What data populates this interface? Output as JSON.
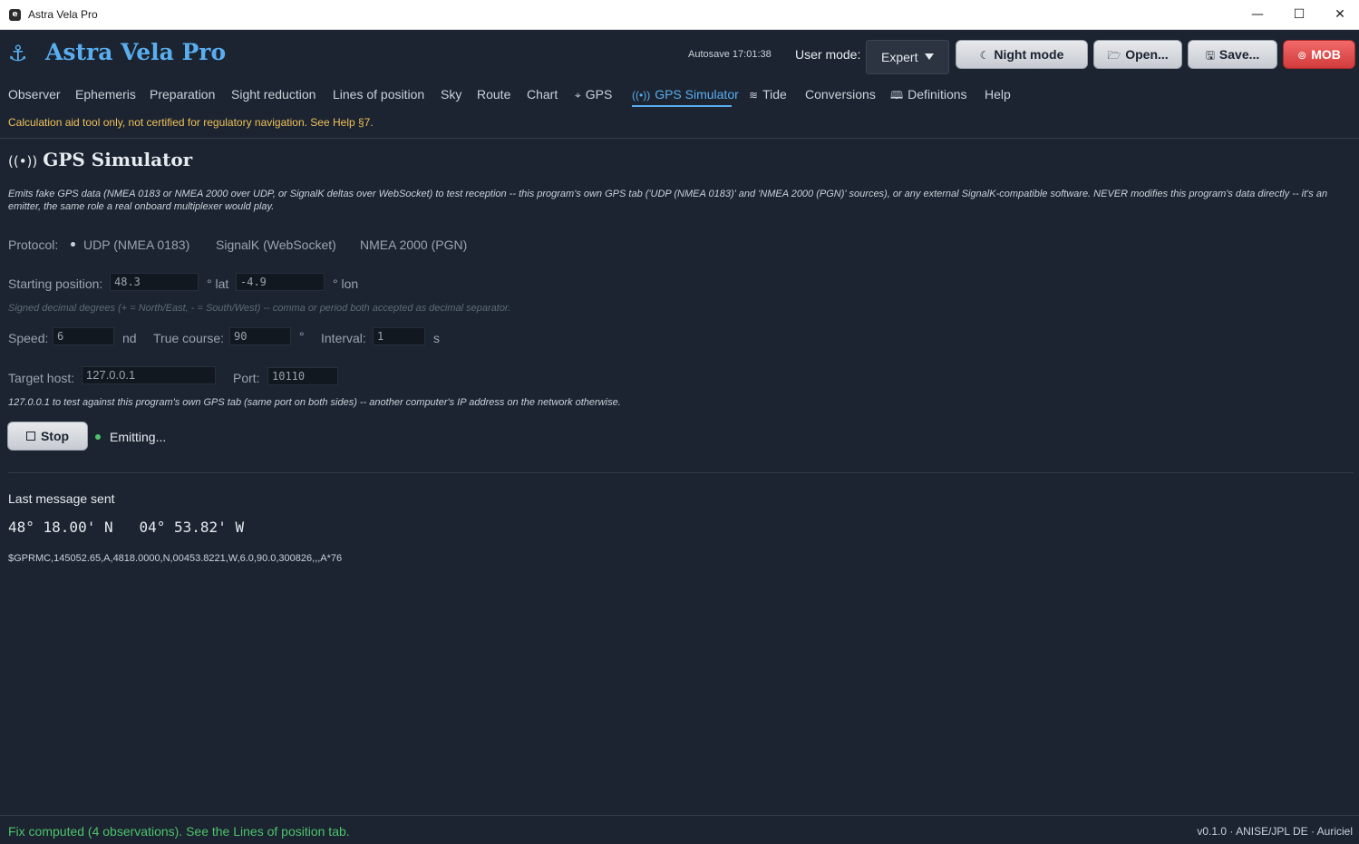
{
  "window": {
    "title": "Astra Vela Pro",
    "app_icon": "e",
    "controls": {
      "minimize": "—",
      "maximize": "☐",
      "close": "✕"
    }
  },
  "header": {
    "brand": "Astra Vela Pro",
    "brand_icon": "anchor-icon",
    "autosave": "Autosave 17:01:38",
    "user_mode_label": "User mode:",
    "user_mode_value": "Expert",
    "buttons": {
      "night_mode": "Night mode",
      "open": "Open...",
      "save": "Save...",
      "mob": "MOB"
    }
  },
  "tabs": [
    {
      "label": "Observer"
    },
    {
      "label": "Ephemeris"
    },
    {
      "label": "Preparation"
    },
    {
      "label": "Sight reduction"
    },
    {
      "label": "Lines of position"
    },
    {
      "label": "Sky"
    },
    {
      "label": "Route"
    },
    {
      "label": "Chart"
    },
    {
      "label": "GPS",
      "icon": "crosshair-icon"
    },
    {
      "label": "GPS Simulator",
      "icon": "broadcast-icon",
      "active": true
    },
    {
      "label": "Tide",
      "icon": "waves-icon"
    },
    {
      "label": "Conversions"
    },
    {
      "label": "Definitions",
      "icon": "book-icon"
    },
    {
      "label": "Help"
    }
  ],
  "disclaimer": "Calculation aid tool only, not certified for regulatory navigation. See Help §7.",
  "page": {
    "title": "GPS Simulator",
    "description": "Emits fake GPS data (NMEA 0183 or NMEA 2000 over UDP, or SignalK deltas over WebSocket) to test reception -- this program's own GPS tab ('UDP (NMEA 0183)' and 'NMEA 2000 (PGN)' sources), or any external SignalK-compatible software. NEVER modifies this program's data directly -- it's an emitter, the same role a real onboard multiplexer would play.",
    "protocol": {
      "label": "Protocol:",
      "options": [
        "UDP (NMEA 0183)",
        "SignalK (WebSocket)",
        "NMEA 2000 (PGN)"
      ],
      "selected": "UDP (NMEA 0183)"
    },
    "start_position": {
      "label": "Starting position:",
      "lat": "48.3",
      "lat_unit": "° lat",
      "lon": "-4.9",
      "lon_unit": "° lon",
      "hint": "Signed decimal degrees (+ = North/East, - = South/West) -- comma or period both accepted as decimal separator."
    },
    "speed": {
      "label": "Speed:",
      "value": "6",
      "unit": "nd"
    },
    "course": {
      "label": "True course:",
      "value": "90",
      "unit": "°"
    },
    "interval": {
      "label": "Interval:",
      "value": "1",
      "unit": "s"
    },
    "target_host": {
      "label": "Target host:",
      "value": "127.0.0.1"
    },
    "port": {
      "label": "Port:",
      "value": "10110"
    },
    "host_hint": "127.0.0.1 to test against this program's own GPS tab (same port on both sides) -- another computer's IP address on the network otherwise.",
    "stop_button": "Stop",
    "status": "Emitting...",
    "last_message": {
      "title": "Last message sent",
      "coords": "48° 18.00' N   04° 53.82' W",
      "sentence": "$GPRMC,145052.65,A,4818.0000,N,00453.8221,W,6.0,90.0,300826,,,A*76"
    }
  },
  "statusbar": {
    "left": "Fix computed (4 observations). See the Lines of position tab.",
    "right": "v0.1.0 · ANISE/JPL DE · Auriciel"
  },
  "colors": {
    "accent": "#5aaef0",
    "warning": "#f0c05a",
    "success": "#4ec36b",
    "mob": "#d23b3b",
    "background": "#1b2430"
  }
}
